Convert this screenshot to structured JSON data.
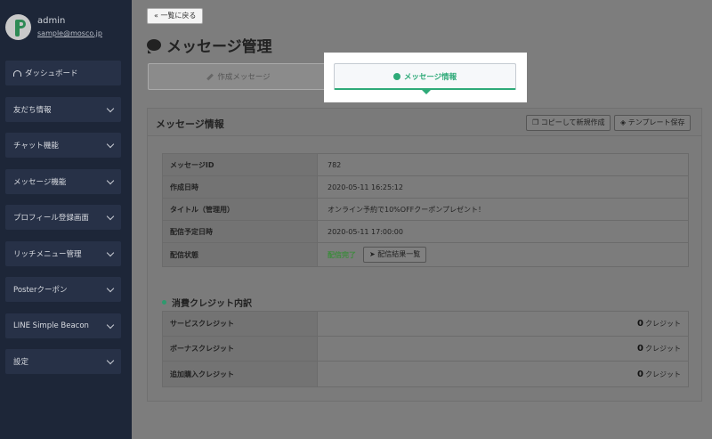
{
  "sidebar": {
    "user": {
      "name": "admin",
      "email": "sample@mosco.jp"
    },
    "items": [
      {
        "label": "ダッシュボード",
        "icon": "dashboard-icon",
        "chevron": false
      },
      {
        "label": "友だち情報",
        "chevron": true
      },
      {
        "label": "チャット機能",
        "chevron": true
      },
      {
        "label": "メッセージ機能",
        "chevron": true
      },
      {
        "label": "プロフィール登録画面",
        "chevron": true
      },
      {
        "label": "リッチメニュー管理",
        "chevron": true
      },
      {
        "label": "Posterクーポン",
        "chevron": true
      },
      {
        "label": "LINE Simple Beacon",
        "chevron": true
      },
      {
        "label": "設定",
        "chevron": true
      }
    ]
  },
  "header": {
    "back_label": "« 一覧に戻る",
    "title": "メッセージ管理"
  },
  "tabs": [
    {
      "label": "作成メッセージ",
      "active": false,
      "icon": "pencil-icon"
    },
    {
      "label": "メッセージ情報",
      "active": true,
      "icon": "info-icon"
    }
  ],
  "panel": {
    "title": "メッセージ情報",
    "copy_label": "コピーして新規作成",
    "template_label": "テンプレート保存",
    "rows": [
      {
        "label": "メッセージID",
        "value": "782"
      },
      {
        "label": "作成日時",
        "value": "2020-05-11 16:25:12"
      },
      {
        "label": "タイトル（管理用）",
        "value": "オンライン予約で10%OFFクーポンプレゼント！"
      },
      {
        "label": "配信予定日時",
        "value": "2020-05-11 17:00:00"
      }
    ],
    "status": {
      "label": "配信状態",
      "value": "配信完了",
      "button": "配信結果一覧"
    },
    "credit": {
      "title": "消費クレジット内訳",
      "unit": "クレジット",
      "rows": [
        {
          "label": "サービスクレジット",
          "value": "0"
        },
        {
          "label": "ボーナスクレジット",
          "value": "0"
        },
        {
          "label": "追加購入クレジット",
          "value": "0"
        }
      ]
    }
  },
  "colors": {
    "accent": "#2eaa78",
    "sidebar": "#1d2638",
    "done": "#3f8a3f"
  }
}
